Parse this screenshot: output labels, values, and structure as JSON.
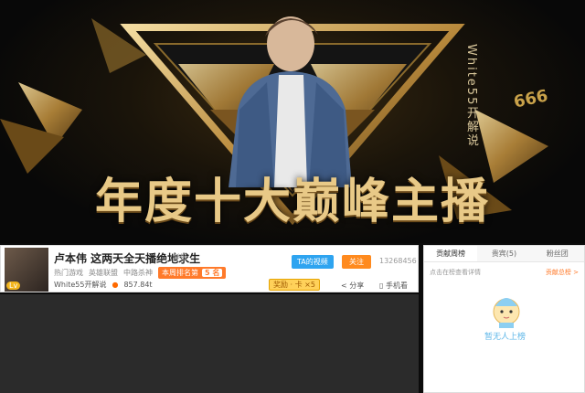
{
  "banner": {
    "title": "年度十大巅峰主播",
    "vertical_text": "White55开解说",
    "badge": "666",
    "colors": {
      "gold": "#e8c987",
      "dark": "#0b0b0b"
    }
  },
  "room": {
    "title": "卢本伟 这两天全天播绝地求生",
    "report": "举报",
    "category": "热门游戏",
    "subcategory": "英雄联盟",
    "league": "中路杀神",
    "week_rank_label": "本周排名第",
    "week_rank_suffix": "5 名",
    "anchor_name": "White55开解说",
    "heat": "857.84t",
    "level_badge": "Lv",
    "subscribe_label": "TA的视频",
    "follow_label": "关注",
    "follow_count": "13268456",
    "gift_label": "奖励 · 卡 ×5",
    "share_label": "分享",
    "phone_label": "手机看"
  },
  "right_panel": {
    "tabs": [
      "贡献周榜",
      "贵宾(5)",
      "粉丝团"
    ],
    "hint": "点击在榜查看详情",
    "more": "贡献总榜 >",
    "empty_text": "暂无人上榜"
  }
}
